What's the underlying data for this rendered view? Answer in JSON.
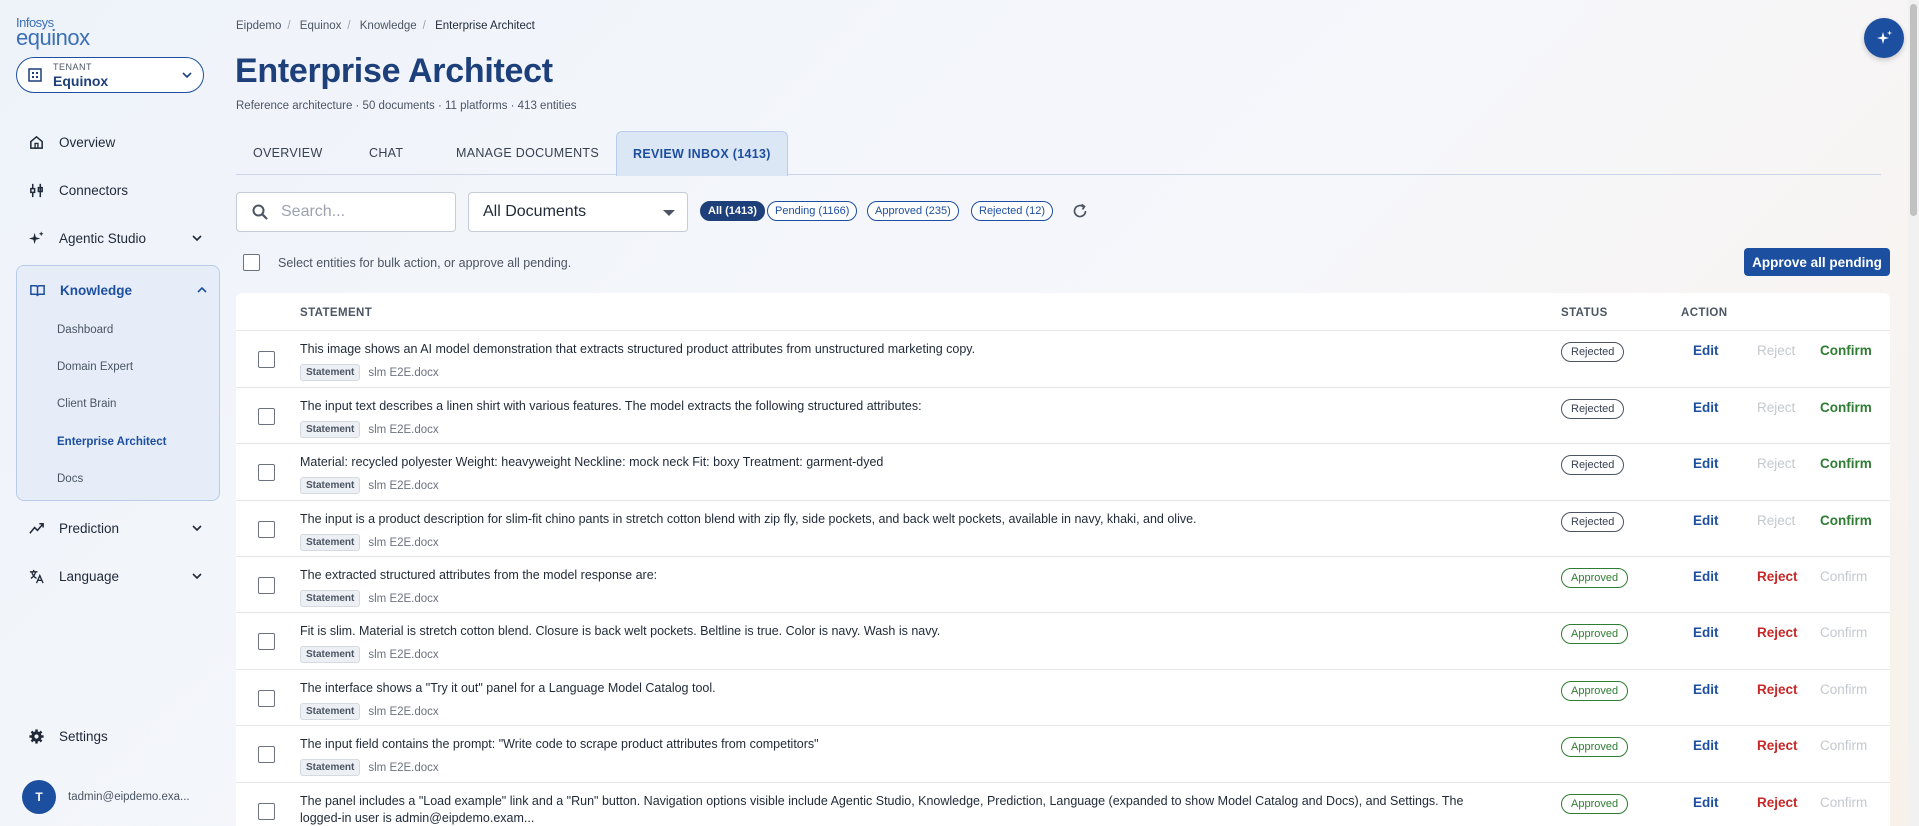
{
  "logo": {
    "line1": "Infosys",
    "line2": "equinox"
  },
  "tenant": {
    "label": "TENANT",
    "value": "Equinox"
  },
  "nav": {
    "overview": "Overview",
    "connectors": "Connectors",
    "agentic_studio": "Agentic Studio",
    "knowledge": "Knowledge",
    "knowledge_items": [
      "Dashboard",
      "Domain Expert",
      "Client Brain",
      "Enterprise Architect",
      "Docs"
    ],
    "prediction": "Prediction",
    "language": "Language",
    "settings": "Settings"
  },
  "user": {
    "initial": "T",
    "email": "tadmin@eipdemo.exa..."
  },
  "breadcrumb": [
    "Eipdemo",
    "Equinox",
    "Knowledge",
    "Enterprise Architect"
  ],
  "page": {
    "title": "Enterprise Architect",
    "subtitle": "Reference architecture · 50 documents · 11 platforms · 413 entities"
  },
  "tabs": [
    "OVERVIEW",
    "CHAT",
    "MANAGE DOCUMENTS",
    "REVIEW INBOX (1413)"
  ],
  "search": {
    "placeholder": "Search...",
    "value": ""
  },
  "doc_filter": {
    "selected": "All Documents"
  },
  "filters": [
    "All (1413)",
    "Pending (1166)",
    "Approved (235)",
    "Rejected (12)"
  ],
  "bulk": {
    "text": "Select entities for bulk action, or approve all pending.",
    "approve_all": "Approve all pending"
  },
  "table": {
    "headers": {
      "statement": "STATEMENT",
      "status": "STATUS",
      "action": "ACTION"
    },
    "actions": {
      "edit": "Edit",
      "reject": "Reject",
      "confirm": "Confirm"
    },
    "rows": [
      {
        "statement": "This image shows an AI model demonstration that extracts structured product attributes from unstructured marketing copy.",
        "type": "Statement",
        "doc": "slm E2E.docx",
        "status": "Rejected"
      },
      {
        "statement": "The input text describes a linen shirt with various features. The model extracts the following structured attributes:",
        "type": "Statement",
        "doc": "slm E2E.docx",
        "status": "Rejected"
      },
      {
        "statement": "Material: recycled polyester Weight: heavyweight Neckline: mock neck Fit: boxy Treatment: garment-dyed",
        "type": "Statement",
        "doc": "slm E2E.docx",
        "status": "Rejected"
      },
      {
        "statement": "The input is a product description for slim-fit chino pants in stretch cotton blend with zip fly, side pockets, and back welt pockets, available in navy, khaki, and olive.",
        "type": "Statement",
        "doc": "slm E2E.docx",
        "status": "Rejected"
      },
      {
        "statement": "The extracted structured attributes from the model response are:",
        "type": "Statement",
        "doc": "slm E2E.docx",
        "status": "Approved"
      },
      {
        "statement": "Fit is slim. Material is stretch cotton blend. Closure is back welt pockets. Beltline is true. Color is navy. Wash is navy.",
        "type": "Statement",
        "doc": "slm E2E.docx",
        "status": "Approved"
      },
      {
        "statement": "The interface shows a \"Try it out\" panel for a Language Model Catalog tool.",
        "type": "Statement",
        "doc": "slm E2E.docx",
        "status": "Approved"
      },
      {
        "statement": "The input field contains the prompt: \"Write code to scrape product attributes from competitors\"",
        "type": "Statement",
        "doc": "slm E2E.docx",
        "status": "Approved"
      },
      {
        "statement": "The panel includes a \"Load example\" link and a \"Run\" button. Navigation options visible include Agentic Studio, Knowledge, Prediction, Language (expanded to show Model Catalog and Docs), and Settings. The logged-in user is admin@eipdemo.exam...",
        "type": "Statement",
        "doc": "slm E2E.docx",
        "status": "Approved"
      }
    ]
  },
  "colors": {
    "primary": "#1d4fa0",
    "approved": "#2e7d32",
    "rejected": "#c62828"
  }
}
